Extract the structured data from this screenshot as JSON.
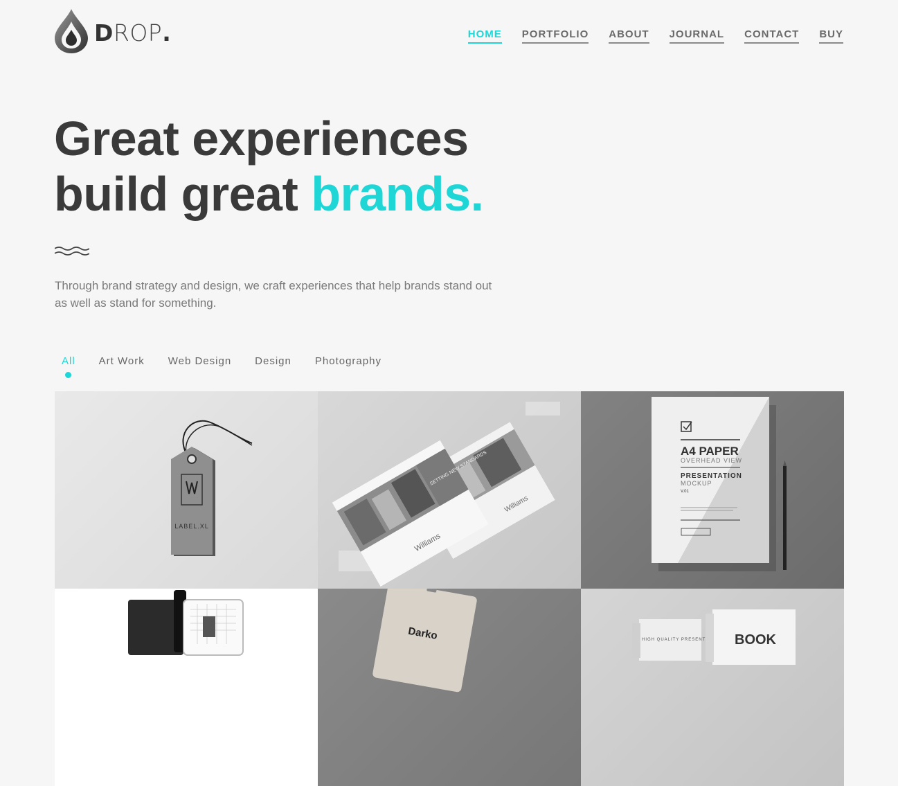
{
  "brand": {
    "name_bold": "D",
    "name_rest": "ROP",
    "name_dot": "."
  },
  "nav": {
    "items": [
      {
        "label": "HOME",
        "active": true
      },
      {
        "label": "PORTFOLIO"
      },
      {
        "label": "ABOUT"
      },
      {
        "label": "JOURNAL"
      },
      {
        "label": "CONTACT"
      },
      {
        "label": "BUY"
      }
    ]
  },
  "hero": {
    "line1": "Great experiences",
    "line2_plain": "build great ",
    "line2_accent": "brands.",
    "intro": "Through brand strategy and design, we craft experiences that help brands stand out as well as stand for something."
  },
  "filters": [
    "All",
    "Art Work",
    "Web Design",
    "Design",
    "Photography"
  ],
  "portfolio": {
    "tiles": [
      {
        "mock_text": "LABEL.XL"
      },
      {
        "mock_text_1": "SETTING NEW STANDARDS",
        "mock_text_2": "Williams"
      },
      {
        "mock_title": "A4 PAPER",
        "mock_sub": "OVERHEAD VIEW",
        "mock_title2": "PRESENTATION",
        "mock_sub2": "MOCKUP",
        "mock_ver": "V.01"
      },
      {},
      {
        "mock_text": "Darko"
      },
      {
        "mock_text_1": "HIGH QUALITY PRESENTATION",
        "mock_text_2": "BOOK"
      }
    ]
  },
  "colors": {
    "accent": "#1fd6d6",
    "text": "#3a3a3a",
    "background": "#f6f6f6"
  }
}
